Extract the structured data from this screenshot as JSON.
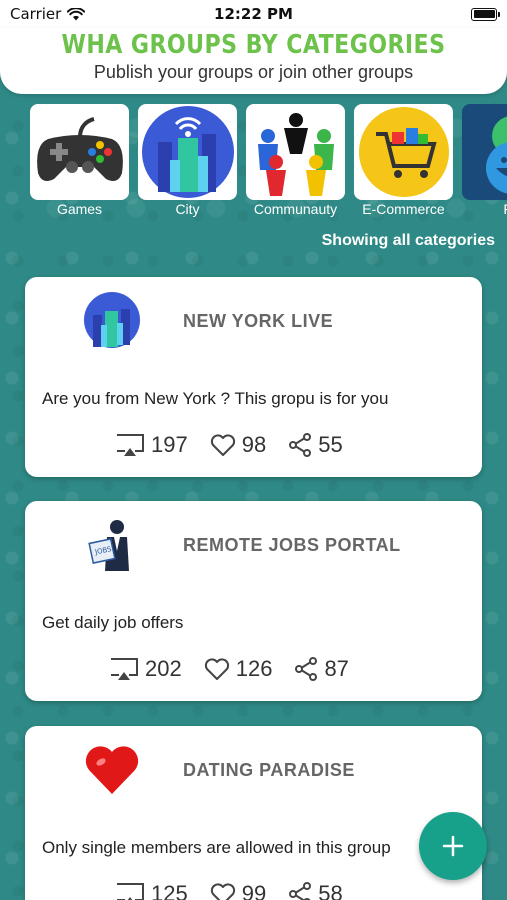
{
  "status_bar": {
    "carrier": "Carrier",
    "time": "12:22 PM"
  },
  "header": {
    "title": "WHA GROUPS BY CATEGORIES",
    "subtitle": "Publish your groups or join other groups"
  },
  "categories": [
    {
      "label": "Games",
      "icon": "gamepad-icon"
    },
    {
      "label": "City",
      "icon": "city-icon"
    },
    {
      "label": "Communauty",
      "icon": "community-icon"
    },
    {
      "label": "E-Commerce",
      "icon": "shopping-cart-icon"
    },
    {
      "label": "Fu",
      "icon": "smiley-icon"
    }
  ],
  "showing_label": "Showing all categories",
  "groups": [
    {
      "title": "NEW YORK LIVE",
      "description": "Are you from New York ? This gropu is for you",
      "views": "197",
      "likes": "98",
      "shares": "55",
      "icon": "city-icon"
    },
    {
      "title": "REMOTE JOBS PORTAL",
      "description": "Get daily job offers",
      "views": "202",
      "likes": "126",
      "shares": "87",
      "icon": "job-seeker-icon"
    },
    {
      "title": "DATING PARADISE",
      "description": "Only single members are allowed in this group",
      "views": "125",
      "likes": "99",
      "shares": "58",
      "icon": "heart-icon"
    }
  ],
  "colors": {
    "accent_green": "#6cc24a",
    "background_teal": "#2f8a87",
    "fab": "#17a08a"
  }
}
